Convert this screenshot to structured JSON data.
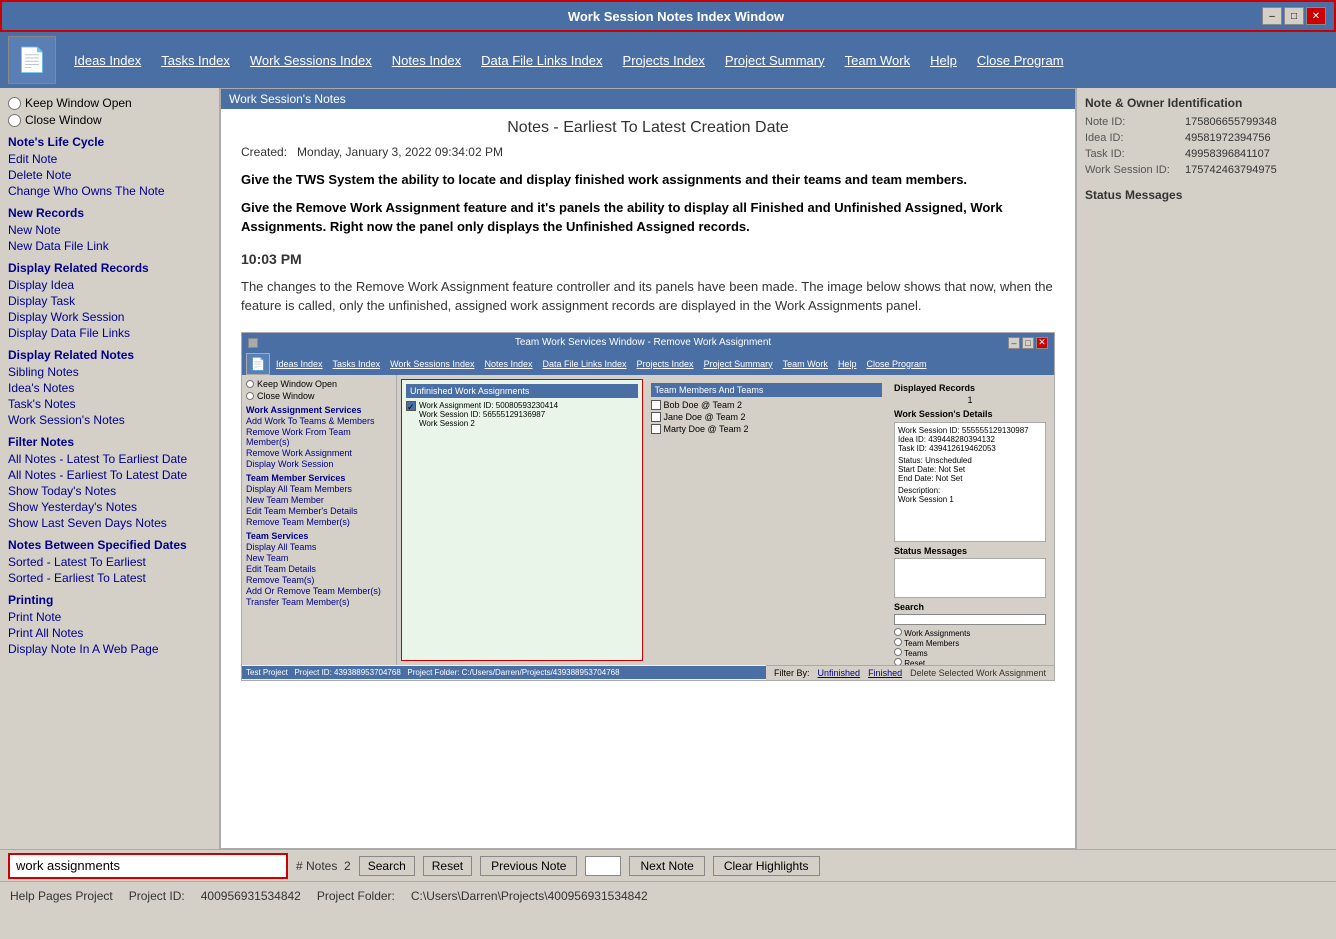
{
  "window": {
    "title": "Work Session Notes Index Window",
    "titlebar_controls": [
      "minimize",
      "restore",
      "close"
    ]
  },
  "menubar": {
    "logo_icon": "📄",
    "items": [
      {
        "label": "Ideas Index",
        "id": "ideas-index"
      },
      {
        "label": "Tasks Index",
        "id": "tasks-index"
      },
      {
        "label": "Work Sessions Index",
        "id": "work-sessions-index"
      },
      {
        "label": "Notes Index",
        "id": "notes-index"
      },
      {
        "label": "Data File Links Index",
        "id": "data-file-links-index"
      },
      {
        "label": "Projects Index",
        "id": "projects-index"
      },
      {
        "label": "Project Summary",
        "id": "project-summary"
      },
      {
        "label": "Team Work",
        "id": "team-work"
      },
      {
        "label": "Help",
        "id": "help"
      },
      {
        "label": "Close Program",
        "id": "close-program"
      }
    ]
  },
  "sidebar": {
    "window_options": [
      {
        "label": "Keep Window Open",
        "id": "keep-open"
      },
      {
        "label": "Close Window",
        "id": "close-window"
      }
    ],
    "sections": [
      {
        "title": "Note's Life Cycle",
        "links": [
          "Edit Note",
          "Delete Note",
          "Change Who Owns The Note"
        ]
      },
      {
        "title": "New Records",
        "links": [
          "New Note",
          "New Data File Link"
        ]
      },
      {
        "title": "Display Related Records",
        "links": [
          "Display Idea",
          "Display Task",
          "Display Work Session",
          "Display Data File Links"
        ]
      },
      {
        "title": "Display Related Notes",
        "links": [
          "Sibling Notes",
          "Idea's Notes",
          "Task's Notes",
          "Work Session's Notes"
        ]
      },
      {
        "title": "Filter Notes",
        "links": [
          "All Notes - Latest To Earliest Date",
          "All Notes - Earliest To Latest Date",
          "Show Today's Notes",
          "Show Yesterday's Notes",
          "Show Last Seven Days Notes"
        ]
      },
      {
        "title": "Notes Between Specified Dates",
        "links": [
          "Sorted - Latest To Earliest",
          "Sorted - Earliest To Latest"
        ]
      },
      {
        "title": "Printing",
        "links": [
          "Print Note",
          "Print All Notes",
          "Display Note In A Web Page"
        ]
      }
    ]
  },
  "content": {
    "header": "Work Session's Notes",
    "note_title": "Notes - Earliest To Latest Creation Date",
    "created_label": "Created:",
    "created_date": "Monday, January 3, 2022  09:34:02 PM",
    "bold_para1": "Give the TWS System the ability to locate and display finished work assignments and their teams and team members.",
    "bold_para2": "Give the Remove Work Assignment feature and it's panels the ability to display all Finished and Unfinished Assigned,  Work Assignments. Right now the panel only displays the Unfinished Assigned records.",
    "time_marker": "10:03 PM",
    "para1": "The changes to the Remove Work Assignment feature controller and its panels have been made. The image below shows that now, when the feature is called, only the unfinished, assigned work assignment records are displayed in the Work Assignments panel.",
    "screenshot": {
      "title": "Team Work Services Window - Remove Work Assignment",
      "menu_items": [
        "Ideas Index",
        "Tasks Index",
        "Work Sessions Index",
        "Notes Index",
        "Data File Links Index",
        "Projects Index",
        "Project Summary",
        "Team Work",
        "Help",
        "Close Program"
      ],
      "sidebar_options": [
        "Keep Window Open",
        "Close Window"
      ],
      "sidebar_sections": [
        {
          "title": "Work Assignment Services",
          "links": [
            "Add Work To Teams & Members",
            "Remove Work From Team Member(s)",
            "Remove Work Assignment",
            "Display Work Session"
          ]
        },
        {
          "title": "Team Member Services",
          "links": [
            "Display All Team Members",
            "New Team Member",
            "Edit Team Member's Details",
            "Remove Team Member(s)"
          ]
        },
        {
          "title": "Team Services",
          "links": [
            "Display All Teams",
            "New Team",
            "Edit Team Details",
            "Remove Team(s)",
            "Add Or Remove Team Member(s)",
            "Transfer Team Member(s)"
          ]
        }
      ],
      "unfinished_panel": {
        "header": "Unfinished Work Assignments",
        "items": [
          {
            "label": "Work Assignment ID: 50080593230414",
            "sub": "Work Session ID: 56555129136987",
            "sub2": "Work Session 2"
          }
        ]
      },
      "team_members_panel": {
        "header": "Team Members And Teams",
        "items": [
          "Bob Doe @ Team 2",
          "Jane Doe @ Team 2",
          "Marty Doe @ Team 2"
        ]
      },
      "displayed_records": "1",
      "details": {
        "title": "Work Session's Details",
        "fields": [
          {
            "label": "Work Session ID:",
            "value": "555555129130987"
          },
          {
            "label": "Idea ID:",
            "value": "439448280394132"
          },
          {
            "label": "Task ID:",
            "value": "439412619462053"
          }
        ]
      },
      "filter_label": "Filter By:",
      "filter_options": [
        "Unfinished",
        "Finished"
      ],
      "delete_btn": "Delete Selected Work Assignment",
      "status_bar": "Test Project   Project ID: 439388953704768   Project Folder: C:/Users/Darren/Projects/439388953704768"
    }
  },
  "right_panel": {
    "identification_title": "Note & Owner Identification",
    "fields": [
      {
        "label": "Note ID:",
        "value": "175806655799348"
      },
      {
        "label": "Idea ID:",
        "value": "49581972394756"
      },
      {
        "label": "Task ID:",
        "value": "49958396841107"
      },
      {
        "label": "Work Session ID:",
        "value": "175742463794975"
      }
    ],
    "status_title": "Status Messages"
  },
  "search_bar": {
    "search_value": "work assignments",
    "notes_label": "# Notes",
    "notes_count": "2",
    "search_btn": "Search",
    "reset_btn": "Reset",
    "prev_btn": "Previous Note",
    "next_btn": "Next Note",
    "clear_btn": "Clear Highlights",
    "note_number": ""
  },
  "status_bar": {
    "project": "Help Pages Project",
    "project_id_label": "Project ID:",
    "project_id": "400956931534842",
    "folder_label": "Project Folder:",
    "folder": "C:\\Users\\Darren\\Projects\\400956931534842"
  }
}
